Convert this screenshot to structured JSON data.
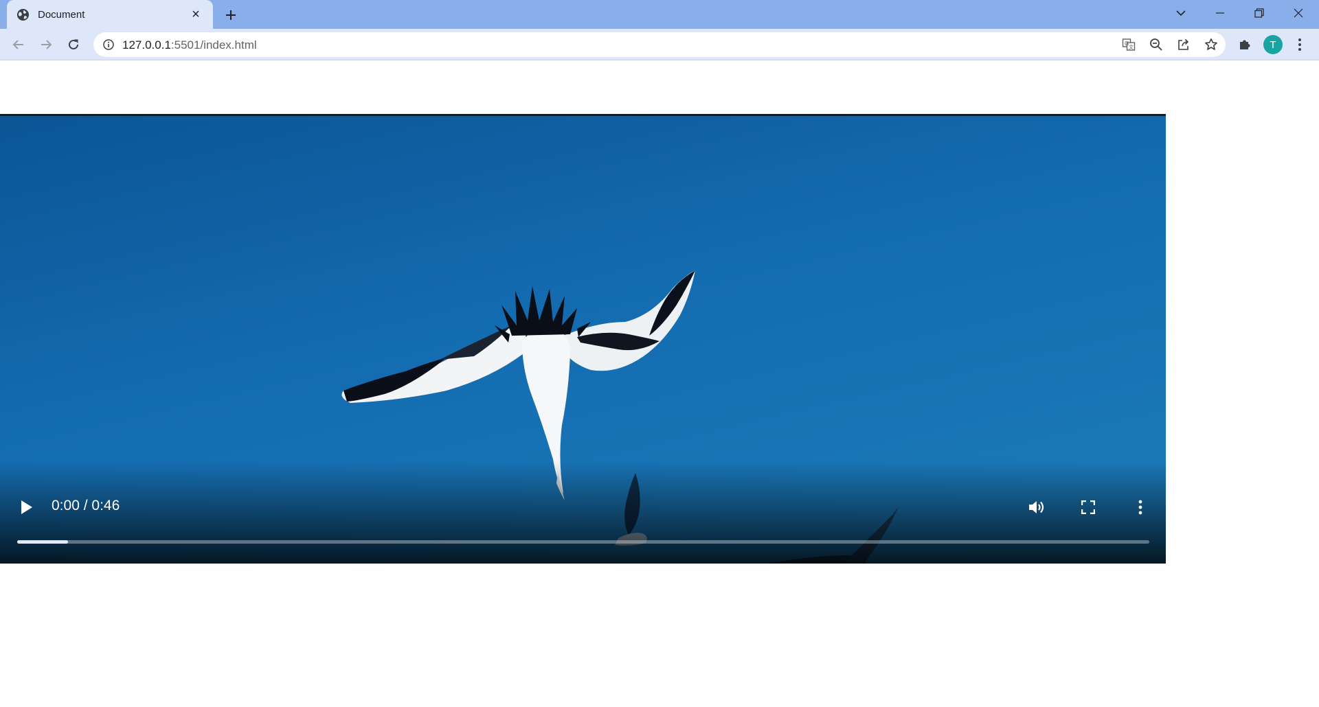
{
  "browser": {
    "tab": {
      "title": "Document",
      "close_glyph": "×",
      "icon": "globe-icon"
    },
    "new_tab_icon": "plus-icon",
    "window_controls": [
      "tab-search-icon",
      "minimize-icon",
      "restore-icon",
      "close-icon"
    ],
    "address_bar": {
      "url_host": "127.0.0.1",
      "url_path": ":5501/index.html",
      "icon": "info-icon"
    },
    "omnibox_actions": [
      "translate-icon",
      "zoom-icon",
      "share-icon",
      "bookmark-star-icon"
    ],
    "profile_initial": "T",
    "colors": {
      "tab_strip": "#8aaeea",
      "toolbar": "#dde7f9",
      "avatar": "#1aa3a3"
    }
  },
  "video": {
    "current_time": "0:00",
    "duration": "0:46",
    "time_separator": " / ",
    "buffered_fraction": 0.045,
    "scene": "birds-diving-blue-sky",
    "controls": [
      "play-icon",
      "volume-icon",
      "fullscreen-icon",
      "more-options-icon"
    ]
  }
}
